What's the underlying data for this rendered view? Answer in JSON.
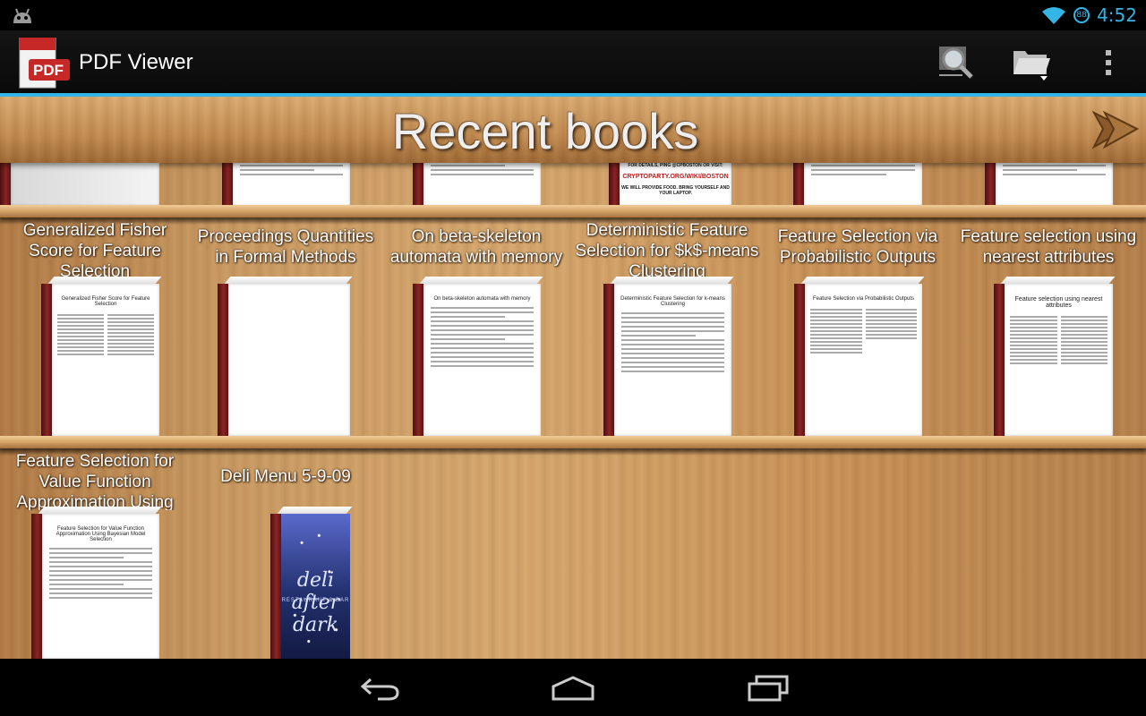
{
  "status_bar": {
    "time": "4:52",
    "battery_level": "88"
  },
  "action_bar": {
    "app_icon_label": "PDF",
    "title": "PDF Viewer",
    "buttons": [
      "search-icon",
      "folder-icon",
      "overflow-menu-icon"
    ]
  },
  "shelf": {
    "title": "Recent books",
    "row2_books": [
      {
        "title": "Generalized Fisher Score for Feature Selection"
      },
      {
        "title": "Proceedings Quantities in Formal Methods"
      },
      {
        "title": "On beta-skeleton automata with memory"
      },
      {
        "title": "Deterministic Feature Selection for $k$-means Clustering"
      },
      {
        "title": "Feature Selection via Probabilistic Outputs"
      },
      {
        "title": "Feature selection using nearest attributes"
      }
    ],
    "row3_books": [
      {
        "title": "Feature Selection for Value Function Approximation Using"
      },
      {
        "title": "Deli Menu 5-9-09"
      }
    ],
    "row1_visible": {
      "crypto_text_red": "CRYPTOPARTY.ORG/WIKI/BOSTON",
      "crypto_text_top": "FOR DETAILS, PING @CPBOSTON OR VISIT:",
      "crypto_text_bottom": "WE WILL PROVIDE FOOD. BRING YOURSELF AND YOUR LAPTOP."
    },
    "page_titles": {
      "fisher": "Generalized Fisher Score for Feature Selection",
      "beta": "On beta-skeleton automata with memory",
      "kmeans": "Deterministic Feature Selection for k-means Clustering",
      "probabilistic": "Feature Selection via Probabilistic Outputs",
      "nearest": "Feature selection using nearest attributes",
      "value_function": "Feature Selection for Value Function Approximation Using Bayesian Model Selection"
    },
    "deli_logo": "deli after dark",
    "deli_sub": "RESTAURANT & BAR"
  },
  "nav_bar": {
    "buttons": [
      "back-icon",
      "home-icon",
      "recent-apps-icon"
    ]
  }
}
